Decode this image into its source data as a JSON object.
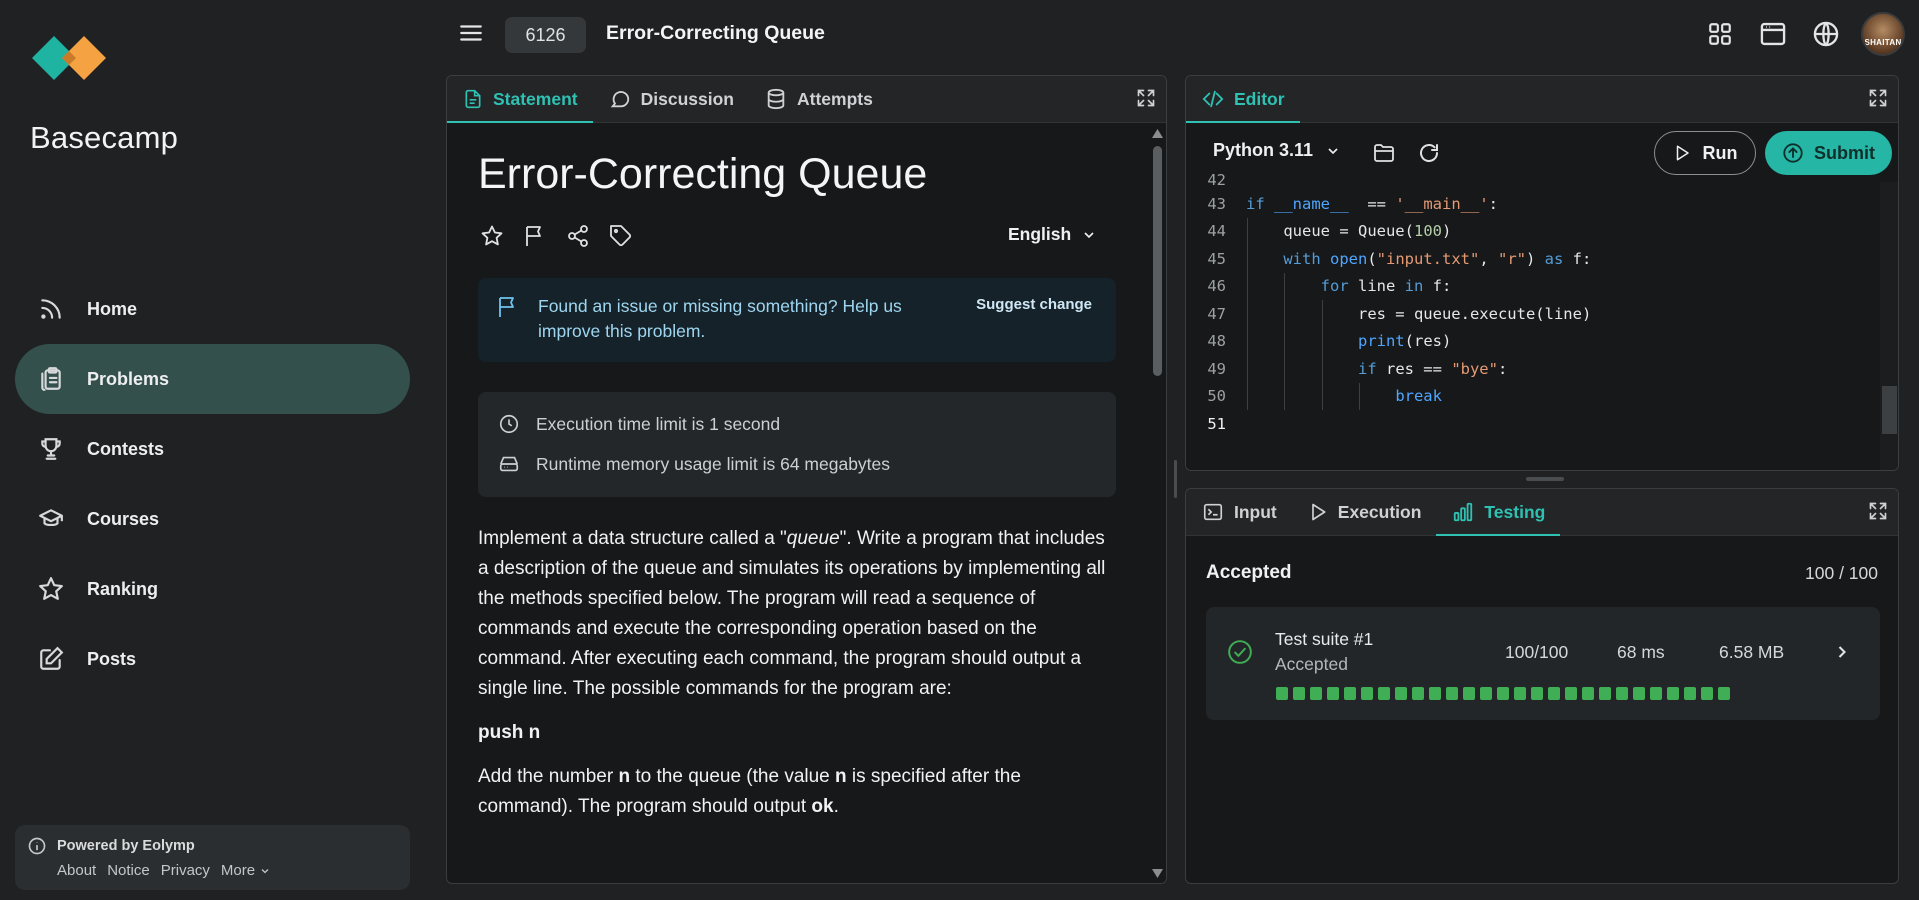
{
  "app": {
    "brand": "Basecamp"
  },
  "sidebar": {
    "items": [
      {
        "label": "Home",
        "icon": "rss-icon",
        "active": false
      },
      {
        "label": "Problems",
        "icon": "clipboard-icon",
        "active": true
      },
      {
        "label": "Contests",
        "icon": "trophy-icon",
        "active": false
      },
      {
        "label": "Courses",
        "icon": "graduation-cap-icon",
        "active": false
      },
      {
        "label": "Ranking",
        "icon": "star-icon",
        "active": false
      },
      {
        "label": "Posts",
        "icon": "edit-icon",
        "active": false
      }
    ],
    "powered": {
      "title": "Powered by Eolymp",
      "links": [
        "About",
        "Notice",
        "Privacy",
        "More"
      ]
    }
  },
  "header": {
    "problem_id": "6126",
    "problem_title": "Error-Correcting Queue",
    "avatar_text": "SHAITAN"
  },
  "statement": {
    "tabs": [
      "Statement",
      "Discussion",
      "Attempts"
    ],
    "title": "Error-Correcting Queue",
    "language": "English",
    "notice": {
      "text": "Found an issue or missing something? Help us improve this problem.",
      "link": "Suggest change"
    },
    "limits": {
      "time": "Execution time limit is 1 second",
      "memory": "Runtime memory usage limit is 64 megabytes"
    },
    "desc": {
      "p1_before": "Implement a data structure called a \"",
      "p1_italic": "queue",
      "p1_after": "\". Write a program that includes a description of the queue and simulates its operations by implementing all the methods specified below. The program will read a sequence of commands and execute the corresponding operation based on the command. After executing each command, the program should output a single line. The possible commands for the program are:",
      "cmd": "push n",
      "p2_a": "Add the number ",
      "p2_n1": "n",
      "p2_b": " to the queue (the value ",
      "p2_n2": "n",
      "p2_c": " is specified after the command). The program should output ",
      "p2_ok": "ok",
      "p2_d": "."
    }
  },
  "editor": {
    "tab": "Editor",
    "language": "Python 3.11",
    "run_label": "Run",
    "submit_label": "Submit",
    "partial_line": "42",
    "lines": [
      {
        "n": "43",
        "segs": [
          [
            "kw",
            "if "
          ],
          [
            "kw2",
            "__name__"
          ],
          [
            "",
            "  == "
          ],
          [
            "str",
            "'__main__'"
          ],
          [
            "",
            ":"
          ]
        ]
      },
      {
        "n": "44",
        "segs": [
          [
            "",
            "    queue = Queue("
          ],
          [
            "num",
            "100"
          ],
          [
            "",
            ")"
          ]
        ]
      },
      {
        "n": "45",
        "segs": [
          [
            "",
            "    "
          ],
          [
            "kw",
            "with "
          ],
          [
            "kw2",
            "open"
          ],
          [
            "",
            "("
          ],
          [
            "str",
            "\"input.txt\""
          ],
          [
            "",
            ", "
          ],
          [
            "str",
            "\"r\""
          ],
          [
            "",
            ") "
          ],
          [
            "kw",
            "as "
          ],
          [
            "",
            "f:"
          ]
        ]
      },
      {
        "n": "46",
        "segs": [
          [
            "",
            "        "
          ],
          [
            "kw",
            "for "
          ],
          [
            "",
            "line "
          ],
          [
            "kw",
            "in "
          ],
          [
            "",
            "f:"
          ]
        ]
      },
      {
        "n": "47",
        "segs": [
          [
            "",
            "            res = queue.execute(line)"
          ]
        ]
      },
      {
        "n": "48",
        "segs": [
          [
            "",
            "            "
          ],
          [
            "kw2",
            "print"
          ],
          [
            "",
            "(res)"
          ]
        ]
      },
      {
        "n": "49",
        "segs": [
          [
            "",
            "            "
          ],
          [
            "kw",
            "if "
          ],
          [
            "",
            "res == "
          ],
          [
            "str",
            "\"bye\""
          ],
          [
            "",
            ":"
          ]
        ]
      },
      {
        "n": "50",
        "segs": [
          [
            "",
            "                "
          ],
          [
            "kw2",
            "break"
          ]
        ]
      },
      {
        "n": "51",
        "segs": []
      }
    ]
  },
  "testing": {
    "tabs": [
      "Input",
      "Execution",
      "Testing"
    ],
    "verdict": "Accepted",
    "score": "100 / 100",
    "suite": {
      "name": "Test suite #1",
      "status": "Accepted",
      "score": "100/100",
      "time": "68 ms",
      "memory": "6.58 MB",
      "tests_passed": 27
    }
  },
  "colors": {
    "accent": "#2fc1b2",
    "sidebar_active": "#34504c",
    "pass": "#3fae54",
    "notice_text": "#9ed6f0"
  }
}
